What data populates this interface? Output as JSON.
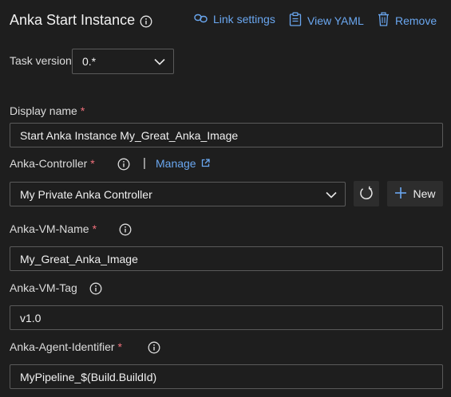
{
  "header": {
    "title": "Anka Start Instance",
    "link_settings_label": "Link settings",
    "view_yaml_label": "View YAML",
    "remove_label": "Remove"
  },
  "task_version": {
    "label": "Task version",
    "value": "0.*"
  },
  "display_name": {
    "label": "Display name",
    "required_mark": "*",
    "value": "Start Anka Instance My_Great_Anka_Image"
  },
  "anka_controller": {
    "label": "Anka-Controller",
    "required_mark": "*",
    "separator": "|",
    "manage_label": "Manage",
    "value": "My Private Anka Controller",
    "new_label": "New"
  },
  "anka_vm_name": {
    "label": "Anka-VM-Name",
    "required_mark": "*",
    "value": "My_Great_Anka_Image"
  },
  "anka_vm_tag": {
    "label": "Anka-VM-Tag",
    "value": "v1.0"
  },
  "anka_agent_identifier": {
    "label": "Anka-Agent-Identifier",
    "required_mark": "*",
    "value": "MyPipeline_$(Build.BuildId)"
  },
  "colors": {
    "background": "#1e1e1e",
    "link": "#6aa7f0",
    "required": "#f1707b",
    "border": "#5a5a5a"
  },
  "icons": [
    "info-icon",
    "link-icon",
    "clipboard-icon",
    "trash-icon",
    "chevron-down-icon",
    "external-link-icon",
    "refresh-icon",
    "plus-icon"
  ]
}
